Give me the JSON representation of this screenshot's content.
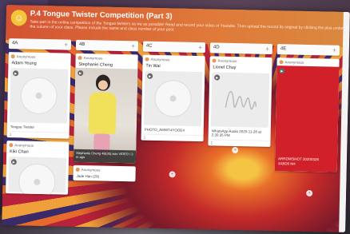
{
  "header": {
    "title": "P.4 Tongue Twister Competition (Part 3)",
    "subtitle": "Take part in the online competition of the Tongue twisters as we as possible! Read and record your video or Youtube. Then upload the record its original by clicking the plus under the column of your class. Please include the name and class number of your post."
  },
  "columns": [
    {
      "label": "4A",
      "cards": [
        {
          "author": "Anonymous",
          "name": "Adam Yeung",
          "caption": "Tongue Twister",
          "foot": "1"
        },
        {
          "author": "Anonymous",
          "name": "Kiki Chan",
          "caption": "",
          "foot": ""
        }
      ]
    },
    {
      "label": "4B",
      "cards": [
        {
          "author": "Anonymous",
          "name": "Stephanie Cheng",
          "caption": "Stephanie Cheng 4B(30).wav  VIDEO / 3 m ago"
        },
        {
          "author": "Anonymous",
          "name": "",
          "caption": "Jade Han (29)"
        }
      ]
    },
    {
      "label": "4C",
      "cards": [
        {
          "author": "Anonymous",
          "name": "Tin Wai",
          "caption": "PHOTO_AMWT4YOOE4",
          "foot": "1"
        }
      ]
    },
    {
      "label": "4D",
      "cards": [
        {
          "author": "Anonymous",
          "name": "Lionel Chuy",
          "caption": "WhatsApp Audio 2020-11-26 at 2.30.35 PM",
          "foot": "1"
        }
      ]
    },
    {
      "label": "4E",
      "cards": [
        {
          "author": "Anonymous",
          "name": "",
          "caption": "ARROWSHOT 20200326 4ABD5 M4",
          "foot": ""
        }
      ]
    }
  ],
  "colors": {
    "header": "#d35233",
    "accent_red": "#d0202a"
  },
  "icons": {
    "avatar": "smiley-icon",
    "play": "play-icon",
    "add": "plus-icon",
    "menu": "menu-icon"
  }
}
